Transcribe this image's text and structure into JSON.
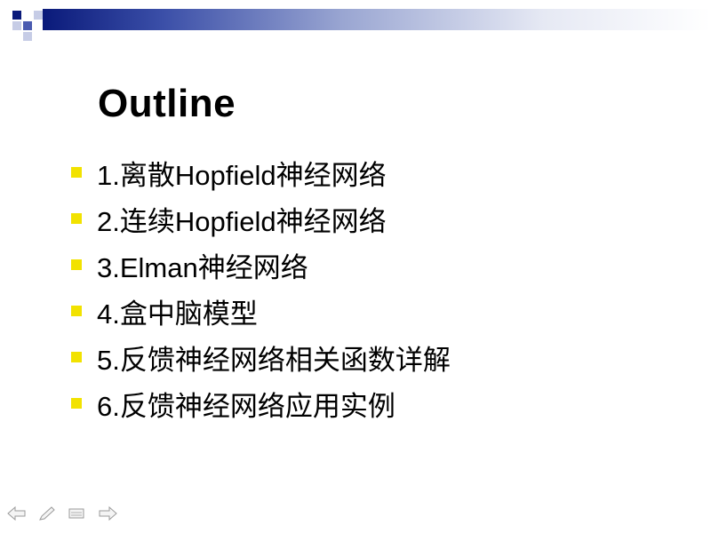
{
  "slide": {
    "title": "Outline",
    "items": [
      {
        "text": "1.离散Hopfield神经网络"
      },
      {
        "text": "2.连续Hopfield神经网络"
      },
      {
        "text": "3.Elman神经网络"
      },
      {
        "text": "4.盒中脑模型"
      },
      {
        "text": "5.反馈神经网络相关函数详解"
      },
      {
        "text": "6.反馈神经网络应用实例"
      }
    ]
  },
  "colors": {
    "bullet": "#f2e200",
    "accent": "#0a1a7a"
  },
  "nav_icons": [
    "back-arrow-icon",
    "pen-icon",
    "menu-icon",
    "forward-arrow-icon"
  ]
}
